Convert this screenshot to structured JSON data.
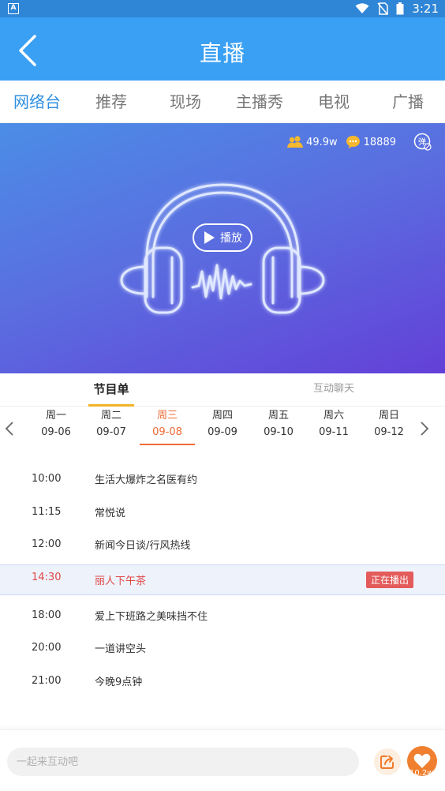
{
  "statusbar": {
    "app_indicator": "A",
    "time": "3:21"
  },
  "header": {
    "title": "直播",
    "back_icon": "chevron-left-icon"
  },
  "tabs": [
    {
      "label": "网络台",
      "active": true
    },
    {
      "label": "推荐"
    },
    {
      "label": "现场"
    },
    {
      "label": "主播秀"
    },
    {
      "label": "电视"
    },
    {
      "label": "广播"
    }
  ],
  "player": {
    "listeners": "49.9w",
    "comments": "18889",
    "danmu_label": "弹",
    "play_label": "播放"
  },
  "subtabs": {
    "program": "节目单",
    "chat": "互动聊天"
  },
  "days": [
    {
      "name": "周一",
      "date": "09-06"
    },
    {
      "name": "周二",
      "date": "09-07"
    },
    {
      "name": "周三",
      "date": "09-08",
      "active": true
    },
    {
      "name": "周四",
      "date": "09-09"
    },
    {
      "name": "周五",
      "date": "09-10"
    },
    {
      "name": "周六",
      "date": "09-11"
    },
    {
      "name": "周日",
      "date": "09-12"
    }
  ],
  "schedule": [
    {
      "time": "10:00",
      "title": "生活大爆炸之名医有约"
    },
    {
      "time": "11:15",
      "title": "常悦说"
    },
    {
      "time": "12:00",
      "title": "新闻今日谈/行风热线"
    },
    {
      "time": "14:30",
      "title": "丽人下午茶",
      "live": true,
      "badge": "正在播出"
    },
    {
      "time": "18:00",
      "title": "爱上下班路之美味挡不住"
    },
    {
      "time": "20:00",
      "title": "一道讲空头"
    },
    {
      "time": "21:00",
      "title": "今晚9点钟"
    }
  ],
  "bottom": {
    "placeholder": "一起来互动吧",
    "like_count": "10.2w"
  },
  "colors": {
    "header": "#3aa0f3",
    "accent_tab": "#2f8fe0",
    "active_day": "#ee6b35",
    "live": "#e04848",
    "like": "#f08030"
  }
}
